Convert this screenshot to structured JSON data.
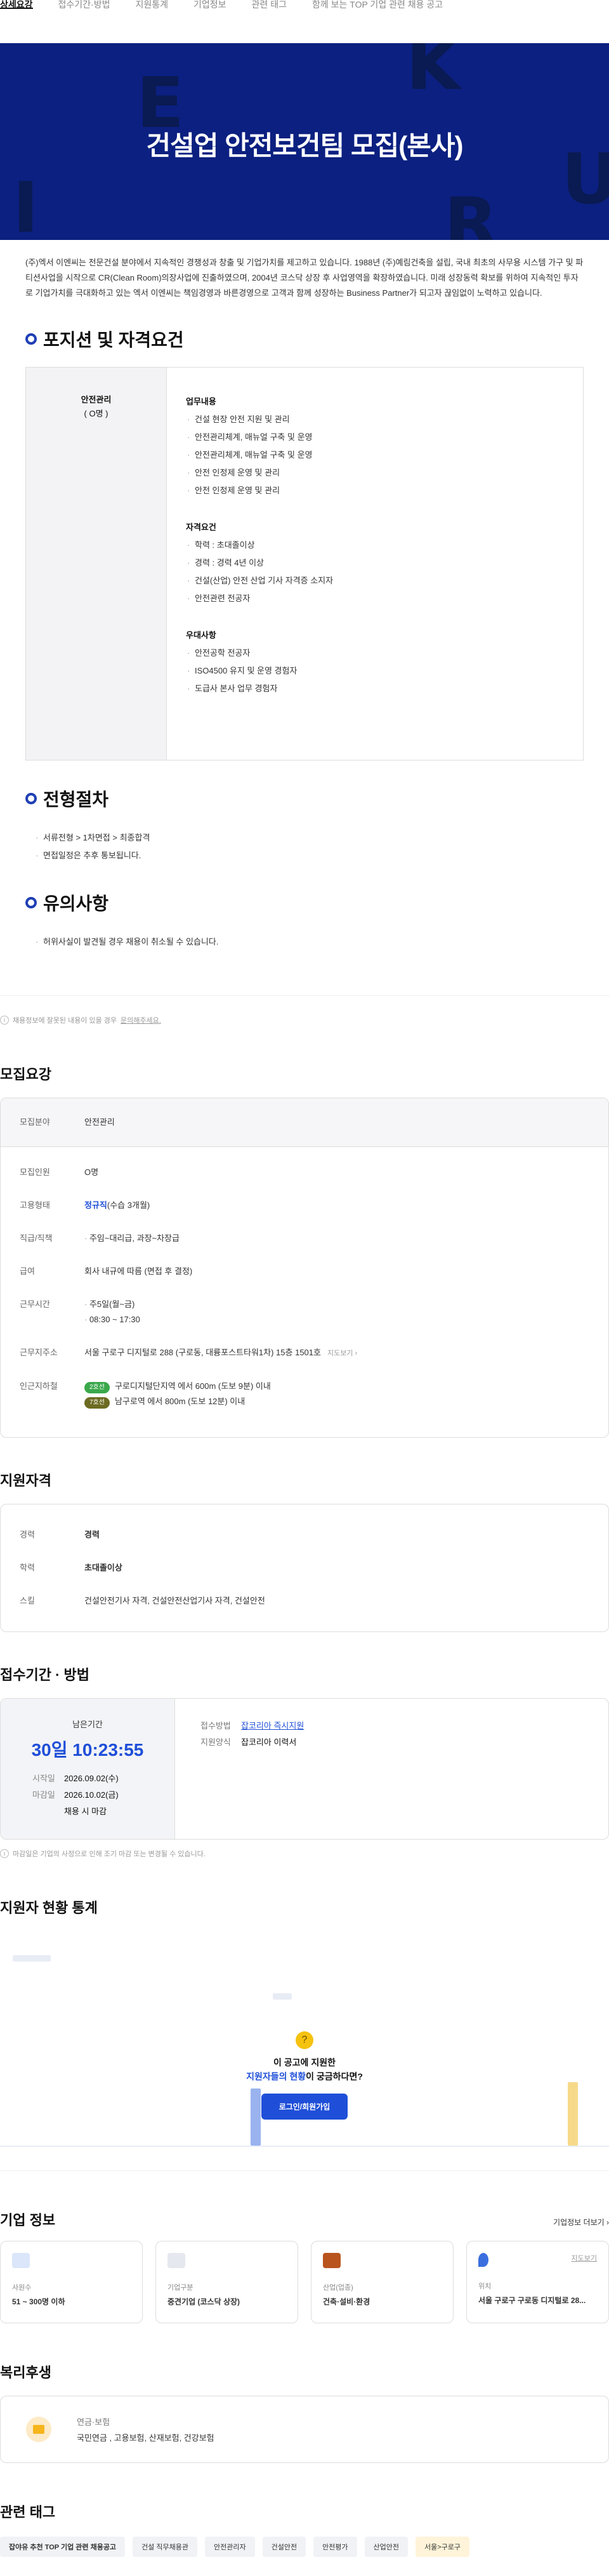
{
  "tabs": [
    "상세요강",
    "접수기간·방법",
    "지원통계",
    "기업정보",
    "관련 태그",
    "함께 보는 TOP 기업 관련 채용 공고"
  ],
  "banner": {
    "title": "건설업 안전보건팀 모집(본사)",
    "letters": [
      "E",
      "K",
      "U",
      "I",
      "R"
    ]
  },
  "intro": "(주)엑서 이엔씨는 전문건설 분야에서 지속적인 경쟁성과 창출 및 기업가치를 제고하고 있습니다. 1988년 (주)예림건축을 설립, 국내 최초의 사무용 시스템 가구 및 파티션사업을 시작으로 CR(Clean Room)의장사업에 진출하였으며, 2004년 코스닥 상장 후 사업영역을 확장하였습니다. 미래 성장동력 확보를 위하여 지속적인 투자로 기업가치를 극대화하고 있는 엑서 이엔씨는 책임경영과 바른경영으로 고객과 함께 성장하는 Business Partner가 되고자 끊임없이 노력하고 있습니다.",
  "position": {
    "heading": "포지션 및 자격요건",
    "left_title": "안전관리",
    "left_sub": "( O명 )",
    "duties_title": "업무내용",
    "duties": [
      "건설 현장 안전 지원 및 관리",
      "안전관리체계, 매뉴얼 구축 및 운영",
      "안전관리체계, 매뉴얼 구축 및 운영",
      "안전 인정제 운영 및 관리",
      "안전 인정제 운영 및 관리"
    ],
    "req_title": "자격요건",
    "reqs": [
      "학력 : 초대졸이상",
      "경력 : 경력 4년 이상",
      "건설(산업) 안전 산업 기사 자격증 소지자",
      "안전관련 전공자"
    ],
    "pref_title": "우대사항",
    "prefs": [
      "안전공학 전공자",
      "ISO4500 유지 및 운영 경험자",
      "도급사 본사 업무 경험자"
    ]
  },
  "process": {
    "heading": "전형절차",
    "items": [
      "서류전형 > 1차면접 > 최종합격",
      "면접일정은 추후 통보됩니다."
    ]
  },
  "caution": {
    "heading": "유의사항",
    "items": [
      "허위사실이 발견될 경우 채용이 취소될 수 있습니다."
    ]
  },
  "notice": {
    "text": "채용정보에 잘못된 내용이 있을 경우",
    "link": "문의해주세요."
  },
  "recruit": {
    "heading": "모집요강",
    "rows": {
      "field_k": "모집분야",
      "field_v": "안전관리",
      "count_k": "모집인원",
      "count_v": "O명",
      "type_k": "고용형태",
      "type_v": "정규직",
      "type_extra": "(수습 3개월)",
      "rank_k": "직급/직책",
      "rank_v": "주임~대리급, 과장~차장급",
      "pay_k": "급여",
      "pay_v": "회사 내규에 따름 (면접 후 결정)",
      "hours_k": "근무시간",
      "hours_1": "주5일(월~금)",
      "hours_2": "08:30 ~ 17:30",
      "addr_k": "근무지주소",
      "addr_v": "서울 구로구 디지털로 288 (구로동, 대륭포스트타워1차) 15층 1501호",
      "addr_link": "지도보기 ›",
      "subway_k": "인근지하철",
      "line2": "2호선",
      "subway_1": "구로디지털단지역 에서 600m (도보 9분) 이내",
      "line7": "7호선",
      "subway_2": "남구로역 에서 800m (도보 12분) 이내"
    }
  },
  "qual": {
    "heading": "지원자격",
    "career_k": "경력",
    "career_v": "경력",
    "edu_k": "학력",
    "edu_v": "초대졸이상",
    "skill_k": "스킬",
    "skill_v": "건설안전기사 자격, 건설안전산업기사 자격, 건설안전"
  },
  "apply": {
    "heading": "접수기간 · 방법",
    "remain_label": "남은기간",
    "remain": "30일 10:23:55",
    "start_k": "시작일",
    "start_v": "2026.09.02(수)",
    "end_k": "마감일",
    "end_v": "2026.10.02(금)",
    "end_note": "채용 시 마감",
    "method_k": "접수방법",
    "method_v": "잡코리아 즉시지원",
    "form_k": "지원양식",
    "form_v": "잡코리아 이력서",
    "note": "마감일은 기업의 사정으로 인해 조기 마감 또는 변경될 수 있습니다."
  },
  "stats": {
    "heading": "지원자 현황 통계",
    "q1": "이 공고에 지원한",
    "q2_hl": "지원자들의 현황",
    "q2_rest": "이 궁금하다면?",
    "btn": "로그인/회원가입"
  },
  "company": {
    "heading": "기업 정보",
    "more": "기업정보 더보기 ›",
    "cards": [
      {
        "label": "사원수",
        "value": "51 ~ 300명 이하",
        "icon": "people-icon",
        "color": "#5b86e5"
      },
      {
        "label": "기업구분",
        "value": "중견기업 (코스닥 상장)",
        "icon": "building-icon",
        "color": "#9aa3b5"
      },
      {
        "label": "산업(업종)",
        "value": "건축·설비·환경",
        "icon": "briefcase-icon",
        "color": "#c0571f"
      },
      {
        "label": "위치",
        "value": "서울 구로구 구로동 디지털로 28...",
        "icon": "pin-icon",
        "color": "#3b6fe0",
        "link": "지도보기"
      }
    ]
  },
  "benefit": {
    "heading": "복리후생",
    "title": "연금·보험",
    "items": "국민연금 , 고용보험, 산재보험, 건강보험"
  },
  "tags": {
    "heading": "관련 태그",
    "items": [
      "잡야유 추천 TOP 기업 관련 채용공고",
      "건설 직무채용관",
      "안전관리자",
      "건설안전",
      "안전평가",
      "산업안전",
      "서울>구로구"
    ]
  }
}
